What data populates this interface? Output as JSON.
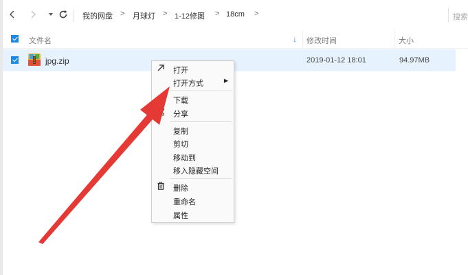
{
  "nav": {
    "back_icon": "chevron-left-icon",
    "forward_icon": "chevron-right-icon",
    "history_icon": "dropdown-caret-icon",
    "refresh_icon": "refresh-icon"
  },
  "breadcrumb": [
    "我的网盘",
    "月球灯",
    "1-12修图",
    "18cm"
  ],
  "search": {
    "placeholder": "搜索"
  },
  "header": {
    "name_label": "文件名",
    "modified_label": "修改时间",
    "size_label": "大小"
  },
  "file": {
    "name": "jpg.zip",
    "modified": "2019-01-12 18:01",
    "size": "94.97MB",
    "icon": "zip-archive-icon"
  },
  "context_menu": {
    "open": "打开",
    "open_with": "打开方式",
    "download": "下载",
    "share": "分享",
    "copy": "复制",
    "cut": "剪切",
    "move_to": "移动到",
    "move_hidden": "移入隐藏空间",
    "delete": "删除",
    "rename": "重命名",
    "properties": "属性"
  },
  "colors": {
    "row_highlight": "#e6f2fd",
    "checkbox_blue": "#1e88e5",
    "annotation_red": "#e53935"
  }
}
